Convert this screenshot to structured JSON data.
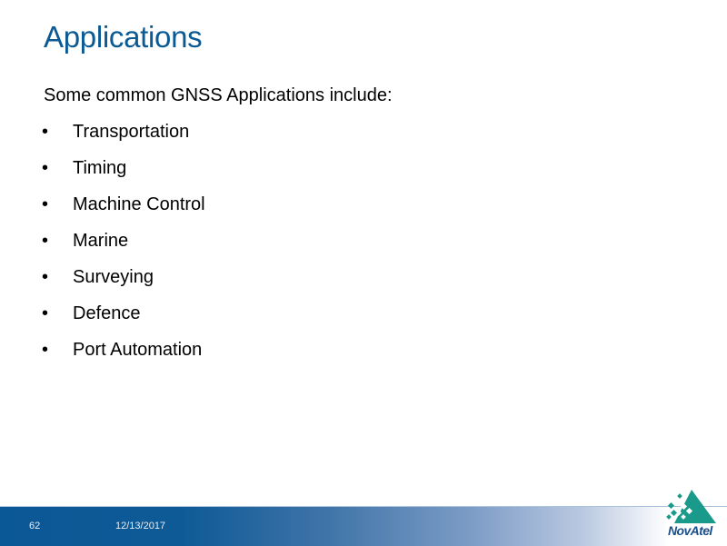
{
  "slide": {
    "title": "Applications",
    "intro": "Some common GNSS Applications include:",
    "bullet_glyph": "•",
    "bullets": [
      "Transportation",
      "Timing",
      "Machine Control",
      "Marine",
      "Surveying",
      "Defence",
      "Port Automation"
    ]
  },
  "footer": {
    "page_number": "62",
    "date": "12/13/2017",
    "logo_text": "NovAtel",
    "logo_icon": "novatel-mountain-logo"
  },
  "colors": {
    "title": "#0b5a94",
    "footer_primary": "#0b5896",
    "logo_green": "#1a9a8a",
    "logo_blue": "#1a4f8c"
  }
}
